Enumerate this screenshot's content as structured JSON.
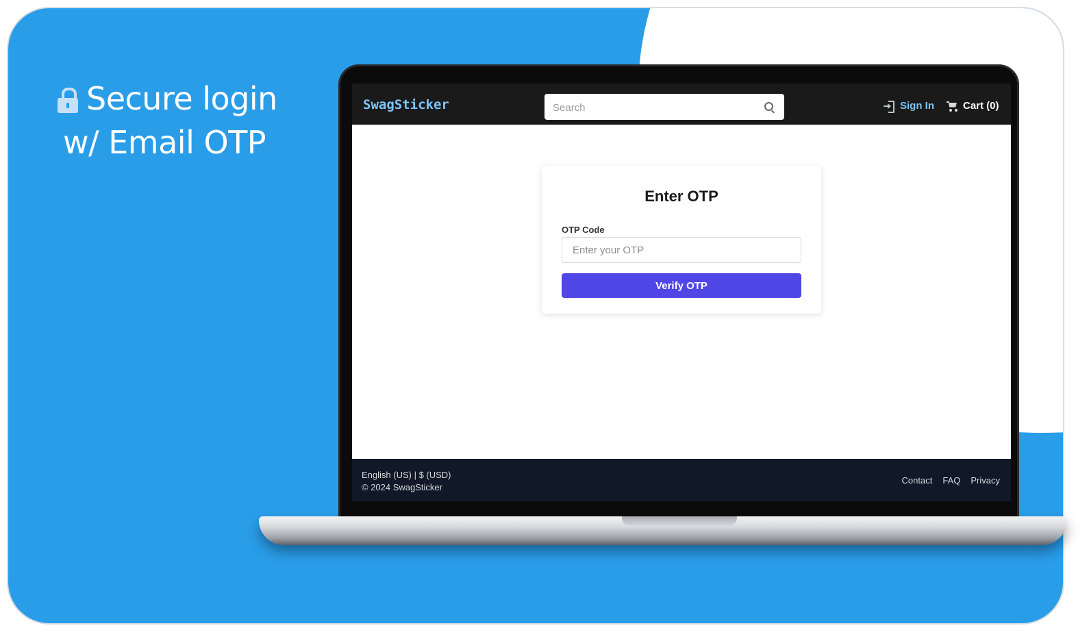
{
  "hero": {
    "line1": "Secure login",
    "line2": "w/ Email OTP",
    "icon": "lock-icon"
  },
  "site": {
    "brand": "SwagSticker",
    "search": {
      "placeholder": "Search"
    },
    "nav": {
      "signin_label": "Sign In",
      "cart_label": "Cart (0)"
    }
  },
  "otp_form": {
    "title": "Enter OTP",
    "field_label": "OTP Code",
    "field_placeholder": "Enter your OTP",
    "field_value": "",
    "submit_label": "Verify OTP"
  },
  "footer": {
    "locale": "English (US) | $ (USD)",
    "copyright": "© 2024 SwagSticker",
    "links": [
      "Contact",
      "FAQ",
      "Privacy"
    ]
  },
  "colors": {
    "background_blue": "#2a9de9",
    "accent_button": "#4f46e5",
    "navbar": "#1a1a1a",
    "footer": "#111827",
    "brand_link": "#7fc4f7"
  }
}
